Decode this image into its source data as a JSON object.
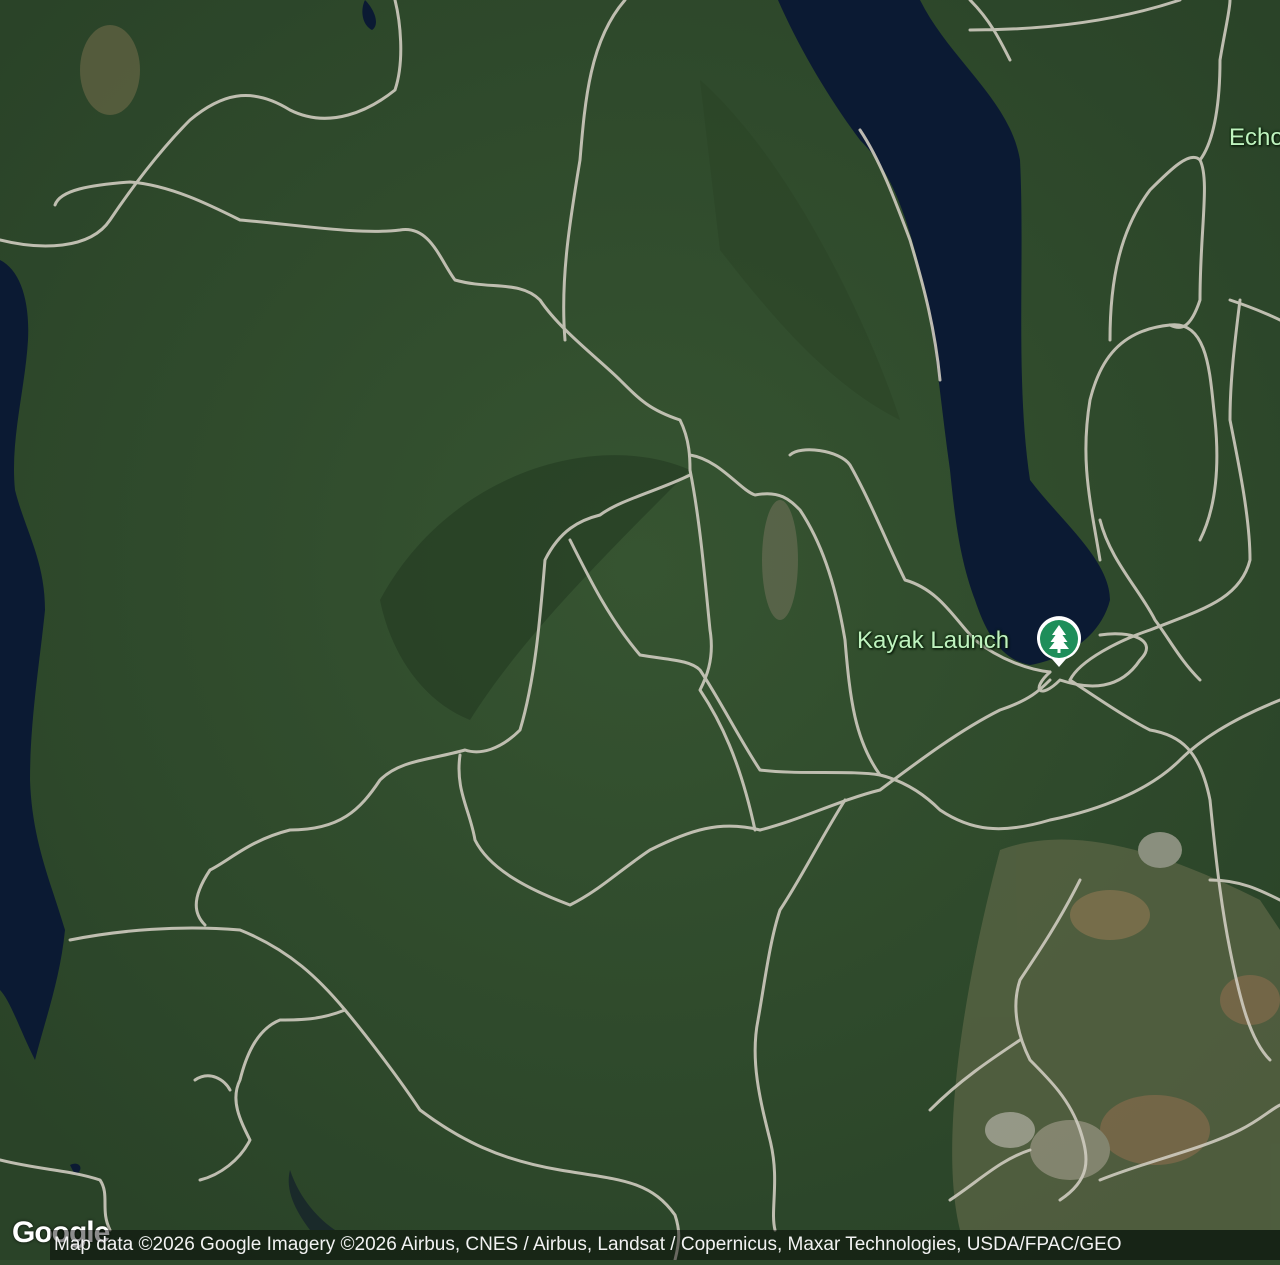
{
  "map": {
    "poi": {
      "label": "Kayak Launch",
      "icon": "tree-icon",
      "color": "#1e8e5a"
    },
    "place_label": "Echo",
    "logo": "Google",
    "attribution": "Map data ©2026 Google Imagery ©2026 Airbus, CNES / Airbus, Landsat / Copernicus, Maxar Technologies, USDA/FPAC/GEO",
    "colors": {
      "forest": "#2f4a2c",
      "lake": "#0b1a33",
      "trail": "#cfcbbf",
      "clearing": "#8a7f63"
    }
  }
}
